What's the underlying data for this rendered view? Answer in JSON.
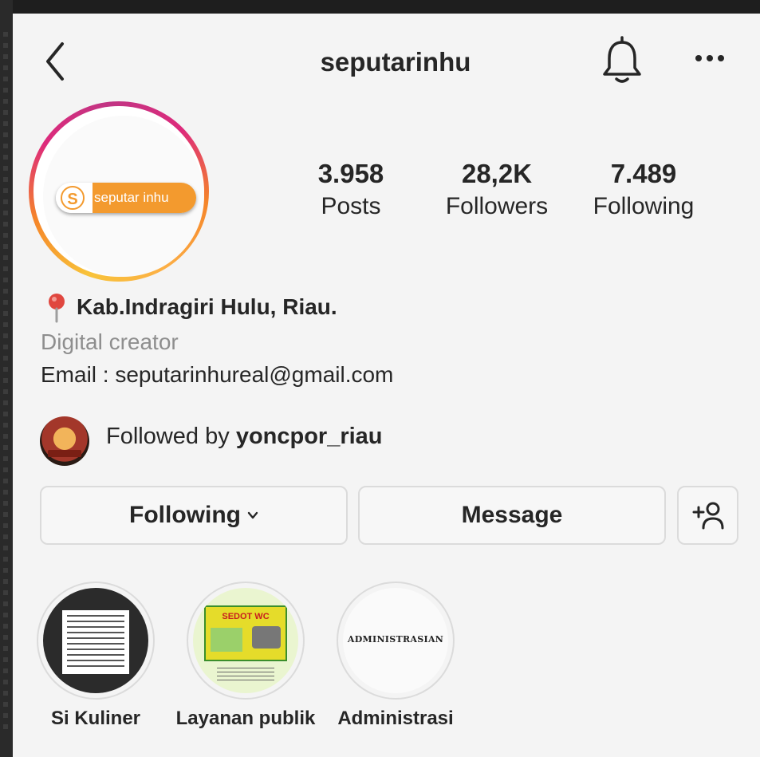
{
  "header": {
    "username": "seputarinhu",
    "back_icon": "chevron-left-icon",
    "bell_icon": "bell-icon",
    "more_icon": "more-horizontal-icon"
  },
  "profile": {
    "avatar_logo_mark": "S",
    "avatar_logo_text": "seputar inhu",
    "stats": [
      {
        "value": "3.958",
        "label": "Posts"
      },
      {
        "value": "28,2K",
        "label": "Followers"
      },
      {
        "value": "7.489",
        "label": "Following"
      }
    ]
  },
  "bio": {
    "location": "Kab.Indragiri Hulu, Riau.",
    "category": "Digital creator",
    "email": "Email : seputarinhureal@gmail.com"
  },
  "followed_by": {
    "prefix": "Followed by ",
    "user": "yoncpor_riau"
  },
  "actions": {
    "following_label": "Following",
    "message_label": "Message",
    "add_person_icon": "add-person-icon"
  },
  "highlights": [
    {
      "label": "Si Kuliner"
    },
    {
      "label": "Layanan publik",
      "cover_title": "SEDOT WC"
    },
    {
      "label": "Administrasi",
      "cover_text": "ADMINISTRASIAN"
    }
  ],
  "colors": {
    "ring_gradient": [
      "#f8c33a",
      "#f58529",
      "#dd2a7b",
      "#c13584"
    ],
    "brand_orange": "#f39a2e",
    "text": "#262626",
    "muted": "#8e8e8e",
    "border": "#dbdbdb"
  }
}
